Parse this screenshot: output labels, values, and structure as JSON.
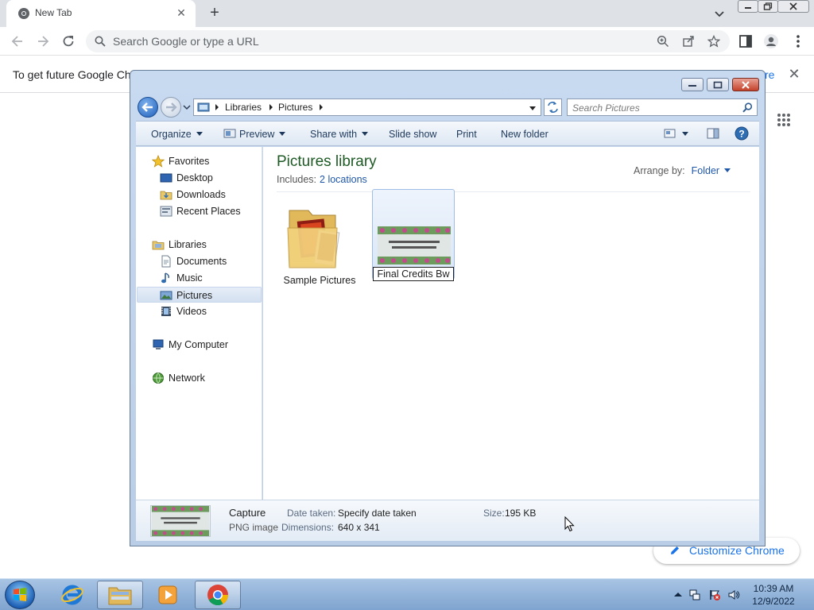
{
  "chrome": {
    "tab_title": "New Tab",
    "omnibox_placeholder": "Search Google or type a URL",
    "infobar_text": "To get future Google Chro",
    "infobar_link": "re",
    "customize_label": "Customize Chrome",
    "colors": {
      "accent": "#1a73e8",
      "tabbar": "#dee1e6"
    }
  },
  "explorer": {
    "breadcrumb": [
      "Libraries",
      "Pictures"
    ],
    "search_placeholder": "Search Pictures",
    "commands": {
      "organize": "Organize",
      "preview": "Preview",
      "share_with": "Share with",
      "slide_show": "Slide show",
      "print": "Print",
      "new_folder": "New folder"
    },
    "nav": {
      "favorites": "Favorites",
      "desktop": "Desktop",
      "downloads": "Downloads",
      "recent_places": "Recent Places",
      "libraries": "Libraries",
      "documents": "Documents",
      "music": "Music",
      "pictures": "Pictures",
      "videos": "Videos",
      "my_computer": "My Computer",
      "network": "Network"
    },
    "content": {
      "title": "Pictures library",
      "includes_label": "Includes:",
      "includes_link": "2 locations",
      "arrange_label": "Arrange by:",
      "arrange_value": "Folder",
      "items": [
        {
          "name": "Sample Pictures",
          "kind": "folder"
        },
        {
          "name": "Final Credits Bw",
          "kind": "image",
          "selected": true
        }
      ]
    },
    "details": {
      "name": "Capture",
      "type": "PNG image",
      "date_taken_label": "Date taken:",
      "date_taken_value": "Specify date taken",
      "dimensions_label": "Dimensions:",
      "dimensions_value": "640 x 341",
      "size_label": "Size:",
      "size_value": "195 KB"
    },
    "colors": {
      "title_green": "#1e5a24",
      "link_blue": "#1f57a8"
    }
  },
  "taskbar": {
    "time": "10:39 AM",
    "date": "12/9/2022"
  }
}
